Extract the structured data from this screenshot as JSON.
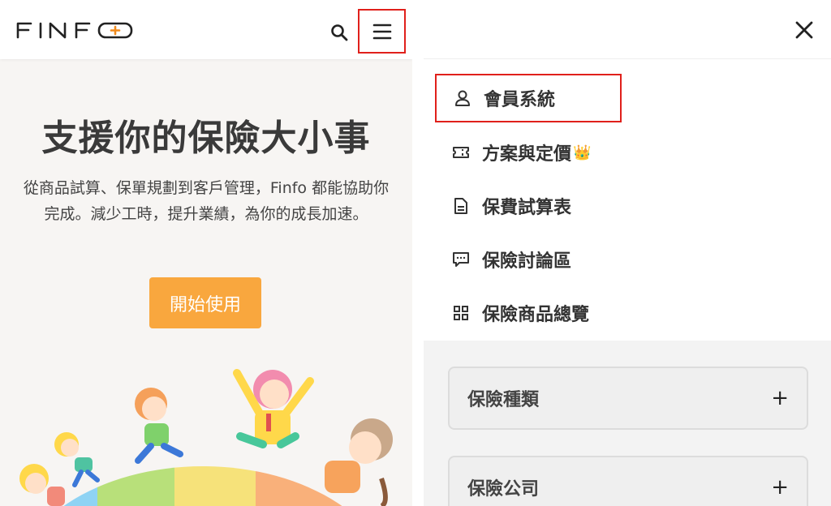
{
  "header": {
    "logo_text": "FINFO",
    "search_icon": "search-icon",
    "menu_icon": "hamburger-menu-icon"
  },
  "hero": {
    "title": "支援你的保險大小事",
    "description": "從商品試算、保單規劃到客戶管理，Finfo 都能協助你完成。減少工時，提升業績，為你的成長加速。",
    "cta_label": "開始使用"
  },
  "drawer": {
    "close_icon": "close-icon",
    "items": [
      {
        "label": "會員系統",
        "icon": "user-icon"
      },
      {
        "label": "方案與定價",
        "icon": "ticket-icon",
        "badge": "👑"
      },
      {
        "label": "保費試算表",
        "icon": "document-icon"
      },
      {
        "label": "保險討論區",
        "icon": "chat-icon"
      },
      {
        "label": "保險商品總覽",
        "icon": "grid-icon"
      }
    ],
    "accordions": [
      {
        "label": "保險種類",
        "toggle": "+"
      },
      {
        "label": "保險公司",
        "toggle": "+"
      }
    ]
  },
  "colors": {
    "accent": "#f9a73e",
    "highlight": "#e0201b"
  }
}
